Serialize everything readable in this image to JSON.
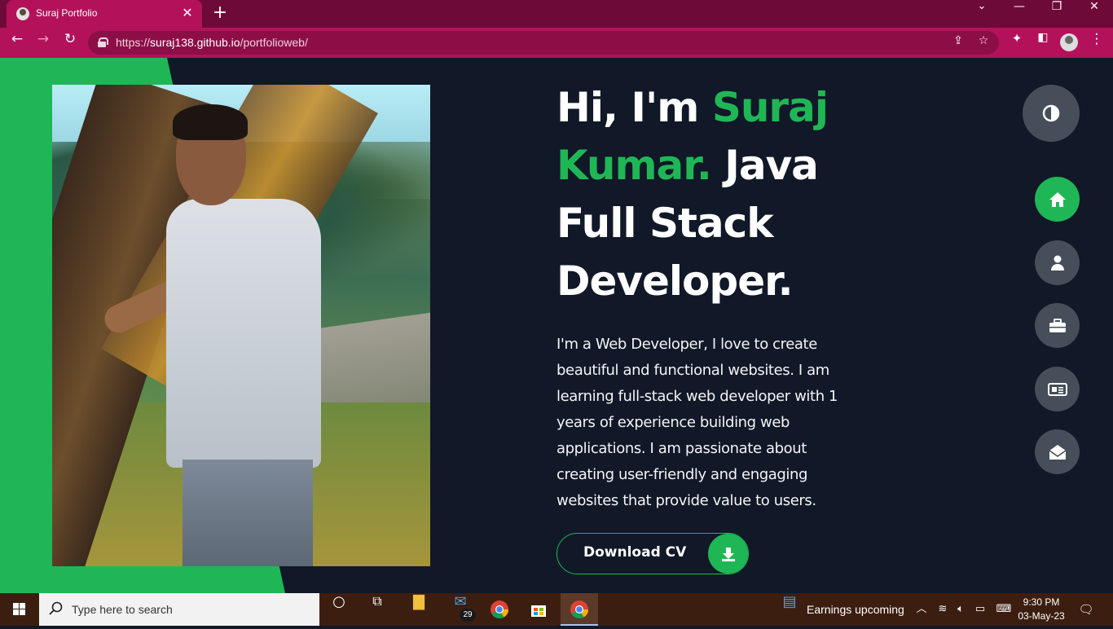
{
  "browser": {
    "tab_title": "Suraj Portfolio",
    "url_scheme": "https://",
    "url_host": "suraj138.github.io",
    "url_path": "/portfolioweb/"
  },
  "hero": {
    "greeting": "Hi, I'm ",
    "name": "Suraj Kumar.",
    "role": " Java Full Stack Developer.",
    "intro": "I'm a Web Developer, I love to create beautiful and functional websites. I am learning full-stack web developer with 1 years of experience building web applications. I am passionate about creating user-friendly and engaging websites that provide value to users.",
    "download_label": "Download CV"
  },
  "side_nav": {
    "items": [
      {
        "name": "home",
        "icon": "home-icon",
        "active": true
      },
      {
        "name": "about",
        "icon": "user-icon",
        "active": false
      },
      {
        "name": "portfolio",
        "icon": "briefcase-icon",
        "active": false
      },
      {
        "name": "blog",
        "icon": "newspaper-icon",
        "active": false
      },
      {
        "name": "contact",
        "icon": "envelope-open-icon",
        "active": false
      }
    ],
    "theme_toggle_icon": "contrast-icon"
  },
  "colors": {
    "accent": "#1fb755",
    "background": "#111827",
    "nav_button": "#454e59",
    "browser_frame": "#b3125a"
  },
  "taskbar": {
    "search_placeholder": "Type here to search",
    "mail_badge": "29",
    "news_text": "Earnings upcoming",
    "time": "9:30 PM",
    "date": "03-May-23"
  }
}
